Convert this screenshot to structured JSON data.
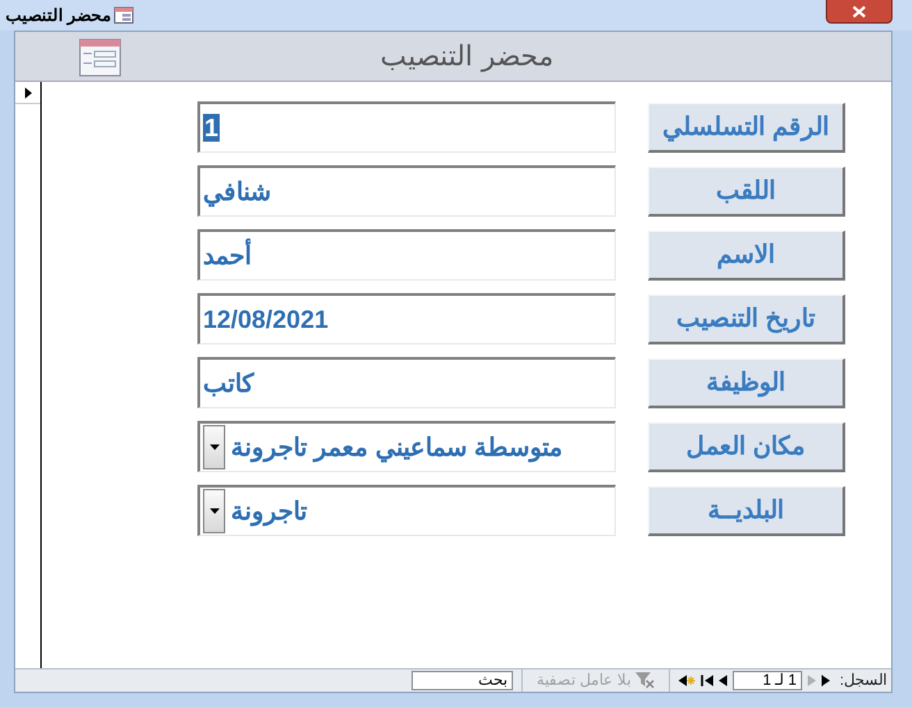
{
  "window": {
    "title": "محضر التنصيب"
  },
  "header": {
    "title": "محضر التنصيب"
  },
  "fields": [
    {
      "kind": "text",
      "label": "الرقم التسلسلي",
      "value": "1",
      "text_selected": true
    },
    {
      "kind": "text",
      "label": "اللقب",
      "value": "شنافي",
      "text_selected": false
    },
    {
      "kind": "text",
      "label": "الاسم",
      "value": "أحمد",
      "text_selected": false
    },
    {
      "kind": "text",
      "label": "تاريخ التنصيب",
      "value": "12/08/2021",
      "text_selected": false
    },
    {
      "kind": "text",
      "label": "الوظيفة",
      "value": "كاتب",
      "text_selected": false
    },
    {
      "kind": "combo",
      "label": "مكان العمل",
      "value": "متوسطة سماعيني معمر تاجرونة",
      "text_selected": false
    },
    {
      "kind": "combo",
      "label": "البلديــة",
      "value": "تاجرونة",
      "text_selected": false
    }
  ],
  "status_bar": {
    "record_label": "السجل:",
    "record_position": "1 لـ 1",
    "next_disabled": true,
    "filter": {
      "label": "بلا عامل تصفية",
      "disabled": true
    },
    "search": {
      "placeholder": "بحث"
    }
  }
}
